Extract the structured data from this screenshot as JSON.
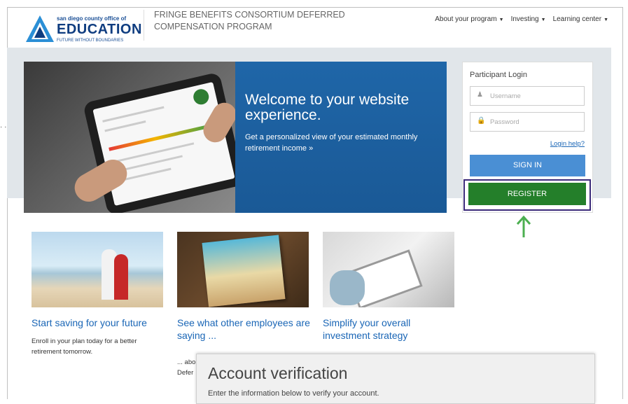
{
  "header": {
    "logo_small": "san diego county office of",
    "logo_big": "EDUCATION",
    "logo_tagline": "FUTURE WITHOUT BOUNDARIES",
    "program_title": "FRINGE BENEFITS CONSORTIUM DEFERRED COMPENSATION PROGRAM",
    "nav": [
      "About your program",
      "Investing",
      "Learning center"
    ]
  },
  "hero": {
    "title": "Welcome to your website experience.",
    "subtitle": "Get a personalized view of your estimated monthly retirement income »"
  },
  "login": {
    "title": "Participant Login",
    "username_placeholder": "Username",
    "password_placeholder": "Password",
    "help_link": "Login help?",
    "signin_label": "SIGN IN",
    "register_label": "REGISTER"
  },
  "cards": [
    {
      "title": "Start saving for your future",
      "text": "Enroll in your plan today for a better retirement tomorrow."
    },
    {
      "title": "See what other employees are saying ...",
      "text": "... abo\nDefer"
    },
    {
      "title": "Simplify your overall investment strategy",
      "text": ""
    }
  ],
  "dialog": {
    "title": "Account verification",
    "subtitle": "Enter the information below to verify your account."
  },
  "colors": {
    "link": "#1a66b6",
    "signin": "#4a8fd4",
    "register": "#247f2a",
    "highlight": "#3b2a7a",
    "arrow": "#4caf50"
  }
}
